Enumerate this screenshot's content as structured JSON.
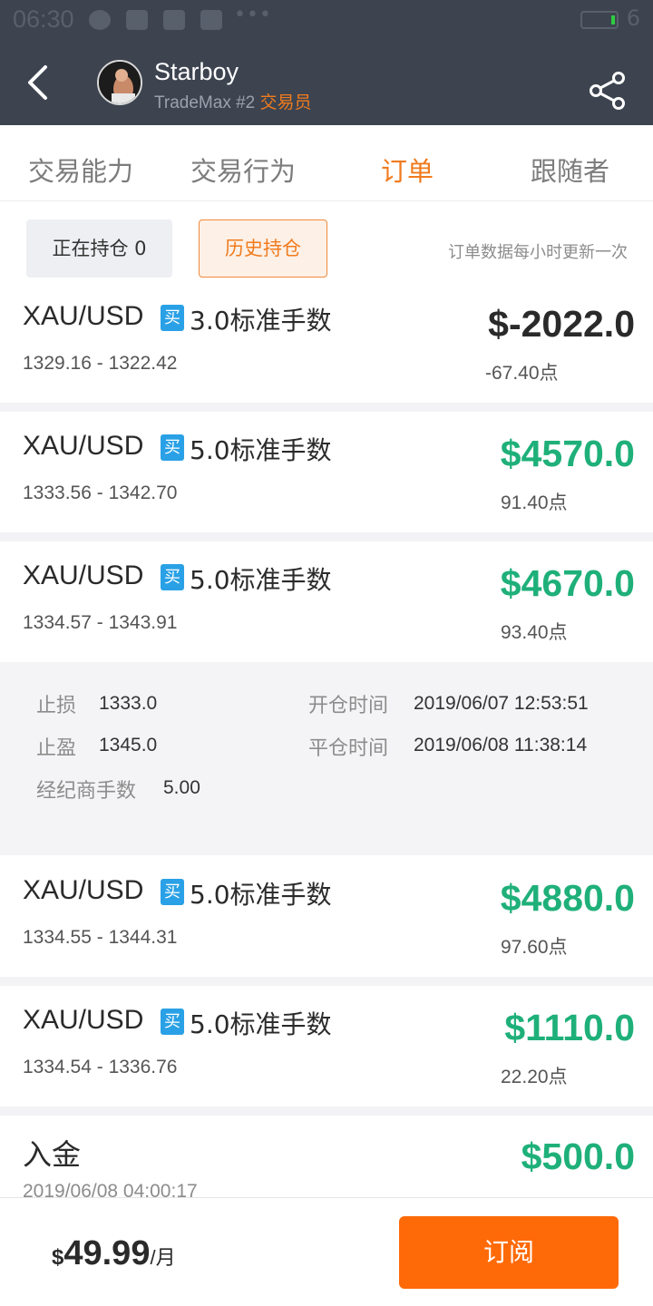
{
  "status_bar": {
    "time": "06:30",
    "battery": "6"
  },
  "header": {
    "name": "Starboy",
    "subtitle": "TradeMax #2",
    "role": "交易员"
  },
  "tabs": [
    {
      "label": "交易能力"
    },
    {
      "label": "交易行为"
    },
    {
      "label": "订单"
    },
    {
      "label": "跟随者"
    }
  ],
  "active_tab": "订单",
  "filters": {
    "open": "正在持仓 0",
    "history": "历史持仓",
    "note": "订单数据每小时更新一次"
  },
  "orders": [
    {
      "symbol": "XAU/USD",
      "side": "买",
      "lots": "3.0标准手数",
      "range": "1329.16 - 1322.42",
      "pnl": "$-2022.0",
      "points": "-67.40点"
    },
    {
      "symbol": "XAU/USD",
      "side": "买",
      "lots": "5.0标准手数",
      "range": "1333.56 - 1342.70",
      "pnl": "$4570.0",
      "points": "91.40点"
    },
    {
      "symbol": "XAU/USD",
      "side": "买",
      "lots": "5.0标准手数",
      "range": "1334.57 - 1343.91",
      "pnl": "$4670.0",
      "points": "93.40点"
    },
    {
      "symbol": "XAU/USD",
      "side": "买",
      "lots": "5.0标准手数",
      "range": "1334.55 - 1344.31",
      "pnl": "$4880.0",
      "points": "97.60点"
    },
    {
      "symbol": "XAU/USD",
      "side": "买",
      "lots": "5.0标准手数",
      "range": "1334.54 - 1336.76",
      "pnl": "$1110.0",
      "points": "22.20点"
    }
  ],
  "detail": {
    "stop_loss_label": "止损",
    "stop_loss": "1333.0",
    "take_profit_label": "止盈",
    "take_profit": "1345.0",
    "broker_lots_label": "经纪商手数",
    "broker_lots": "5.00",
    "open_time_label": "开仓时间",
    "open_time": "2019/06/07 12:53:51",
    "close_time_label": "平仓时间",
    "close_time": "2019/06/08 11:38:14"
  },
  "deposit": {
    "title": "入金",
    "amount": "$500.0",
    "date": "2019/06/08 04:00:17"
  },
  "subscription": {
    "currency": "$",
    "price": "49.99",
    "period": "/月",
    "button": "订阅"
  },
  "colors": {
    "accent": "#f07b1e",
    "profit": "#1fb07a",
    "header_bg": "#3d4450",
    "badge": "#2aa1e6",
    "subscribe": "#ff6a08"
  }
}
